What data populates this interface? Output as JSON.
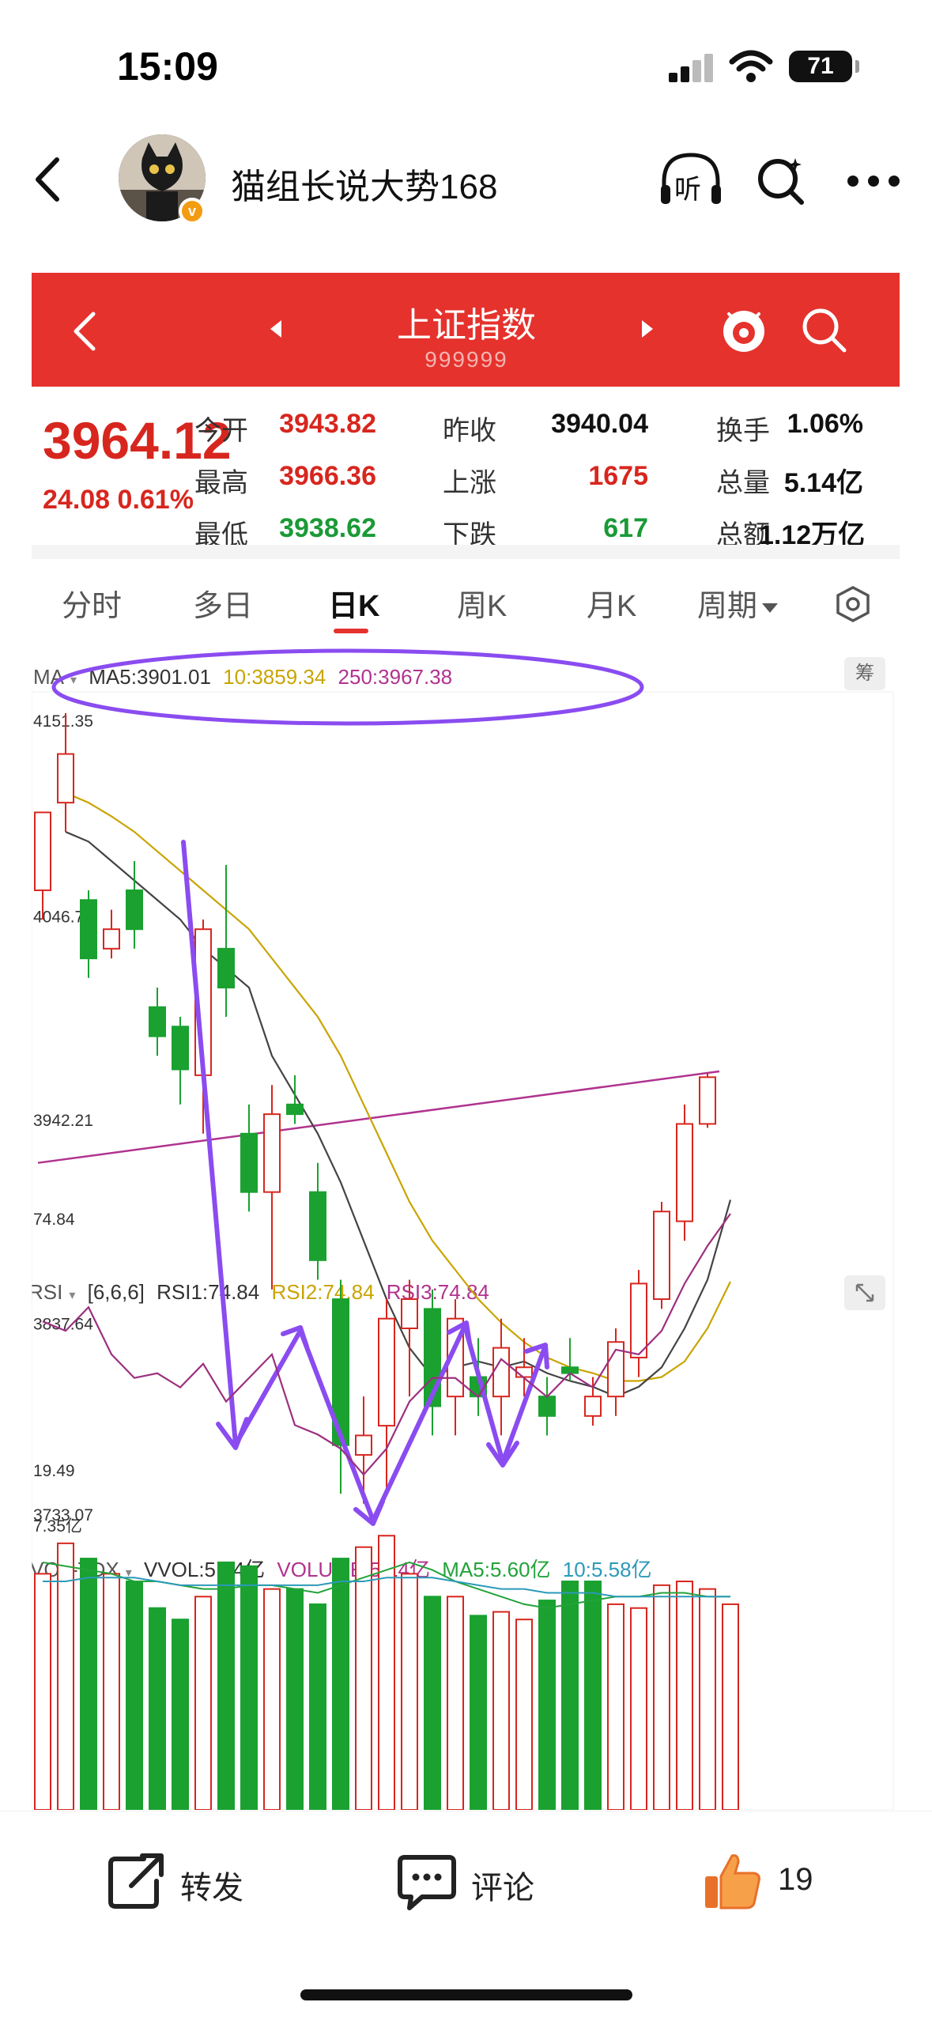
{
  "status_bar": {
    "time": "15:09",
    "battery": "71"
  },
  "nav": {
    "username": "猫组长说大势168",
    "listen_label": "听"
  },
  "quote_app": {
    "title": "上证指数",
    "code": "999999",
    "price": "3964.12",
    "change": "24.08 0.61%",
    "rows": [
      [
        {
          "label": "今开",
          "value": "3943.82",
          "color": "red"
        },
        {
          "label": "昨收",
          "value": "3940.04",
          "color": "dark"
        },
        {
          "label": "换手",
          "value": "1.06%",
          "color": "dark"
        }
      ],
      [
        {
          "label": "最高",
          "value": "3966.36",
          "color": "red"
        },
        {
          "label": "上涨",
          "value": "1675",
          "color": "red"
        },
        {
          "label": "总量",
          "value": "5.14亿",
          "color": "dark"
        }
      ],
      [
        {
          "label": "最低",
          "value": "3938.62",
          "color": "green"
        },
        {
          "label": "下跌",
          "value": "617",
          "color": "green"
        },
        {
          "label": "总额",
          "value": "1.12万亿",
          "color": "dark"
        }
      ]
    ],
    "tabs": [
      "分时",
      "多日",
      "日K",
      "周K",
      "月K",
      "周期"
    ],
    "active_tab": "日K",
    "ma_toggle_label": "筹"
  },
  "indicators": {
    "ma": {
      "name": "MA",
      "ma5": "MA5:3901.01",
      "ma10": "10:3859.34",
      "ma250": "250:3967.38"
    },
    "rsi": {
      "name": "RSI",
      "params": "[6,6,6]",
      "rsi1": "RSI1:74.84",
      "rsi2": "RSI2:74.84",
      "rsi3": "RSI3:74.84"
    },
    "vol": {
      "name": "VOL-TDX",
      "vvol": "VVOL:5.34亿",
      "volume": "VOLUME:5.14亿",
      "ma5": "MA5:5.60亿",
      "ma10": "10:5.58亿"
    }
  },
  "chart_data": [
    {
      "type": "candlestick",
      "title": "",
      "y_ticks": [
        "4151.35",
        "4046.78",
        "3942.21",
        "3837.64",
        "3733.07"
      ],
      "ylim": [
        3733.07,
        4151.35
      ],
      "candles": [
        {
          "o": 4060,
          "h": 4100,
          "l": 4045,
          "c": 4100,
          "up": true
        },
        {
          "o": 4105,
          "h": 4151,
          "l": 4090,
          "c": 4130,
          "up": true
        },
        {
          "o": 4055,
          "h": 4060,
          "l": 4015,
          "c": 4025,
          "up": false
        },
        {
          "o": 4030,
          "h": 4050,
          "l": 4025,
          "c": 4040,
          "up": true
        },
        {
          "o": 4060,
          "h": 4075,
          "l": 4030,
          "c": 4040,
          "up": false
        },
        {
          "o": 4000,
          "h": 4010,
          "l": 3975,
          "c": 3985,
          "up": false
        },
        {
          "o": 3990,
          "h": 3995,
          "l": 3950,
          "c": 3968,
          "up": false
        },
        {
          "o": 3965,
          "h": 4045,
          "l": 3935,
          "c": 4040,
          "up": true
        },
        {
          "o": 4030,
          "h": 4073,
          "l": 3995,
          "c": 4010,
          "up": false
        },
        {
          "o": 3935,
          "h": 3950,
          "l": 3895,
          "c": 3905,
          "up": false
        },
        {
          "o": 3905,
          "h": 3960,
          "l": 3855,
          "c": 3945,
          "up": true
        },
        {
          "o": 3945,
          "h": 3965,
          "l": 3940,
          "c": 3950,
          "up": false
        },
        {
          "o": 3905,
          "h": 3920,
          "l": 3860,
          "c": 3870,
          "up": false
        },
        {
          "o": 3850,
          "h": 3860,
          "l": 3750,
          "c": 3775,
          "up": false
        },
        {
          "o": 3770,
          "h": 3800,
          "l": 3745,
          "c": 3780,
          "up": true
        },
        {
          "o": 3785,
          "h": 3850,
          "l": 3750,
          "c": 3840,
          "up": true
        },
        {
          "o": 3835,
          "h": 3860,
          "l": 3800,
          "c": 3850,
          "up": true
        },
        {
          "o": 3845,
          "h": 3855,
          "l": 3780,
          "c": 3795,
          "up": false
        },
        {
          "o": 3800,
          "h": 3850,
          "l": 3780,
          "c": 3840,
          "up": true
        },
        {
          "o": 3810,
          "h": 3830,
          "l": 3790,
          "c": 3800,
          "up": false
        },
        {
          "o": 3800,
          "h": 3840,
          "l": 3780,
          "c": 3825,
          "up": true
        },
        {
          "o": 3810,
          "h": 3830,
          "l": 3800,
          "c": 3815,
          "up": true
        },
        {
          "o": 3800,
          "h": 3810,
          "l": 3780,
          "c": 3790,
          "up": false
        },
        {
          "o": 3815,
          "h": 3830,
          "l": 3808,
          "c": 3812,
          "up": false
        },
        {
          "o": 3790,
          "h": 3810,
          "l": 3785,
          "c": 3800,
          "up": true
        },
        {
          "o": 3800,
          "h": 3835,
          "l": 3790,
          "c": 3828,
          "up": true
        },
        {
          "o": 3820,
          "h": 3865,
          "l": 3810,
          "c": 3858,
          "up": true
        },
        {
          "o": 3850,
          "h": 3900,
          "l": 3845,
          "c": 3895,
          "up": true
        },
        {
          "o": 3890,
          "h": 3950,
          "l": 3880,
          "c": 3940,
          "up": true
        },
        {
          "o": 3940,
          "h": 3966,
          "l": 3938,
          "c": 3964,
          "up": true
        }
      ],
      "ma5": [
        4090,
        4085,
        4075,
        4065,
        4055,
        4045,
        4030,
        4020,
        4010,
        3975,
        3955,
        3935,
        3910,
        3880,
        3850,
        3825,
        3810,
        3815,
        3818,
        3815,
        3818,
        3812,
        3808,
        3805,
        3800,
        3805,
        3815,
        3835,
        3860,
        3901
      ],
      "ma10": [
        4110,
        4105,
        4098,
        4090,
        4080,
        4070,
        4060,
        4050,
        4040,
        4025,
        4010,
        3995,
        3975,
        3950,
        3925,
        3900,
        3880,
        3865,
        3850,
        3838,
        3828,
        3820,
        3815,
        3812,
        3808,
        3808,
        3810,
        3818,
        3835,
        3859
      ],
      "ma250": [
        3920,
        3967
      ],
      "annotations": "purple ellipse around MA line and hand-drawn purple arrows forming W pattern with upward projection"
    },
    {
      "type": "line",
      "title": "",
      "y_ticks": [
        "74.84",
        "19.49"
      ],
      "ylim": [
        19.49,
        74.84
      ],
      "rsi": [
        52,
        50,
        55,
        45,
        40,
        41,
        38,
        43,
        35,
        40,
        45,
        30,
        28,
        25,
        19.5,
        25,
        35,
        40,
        40,
        36,
        44,
        40,
        36,
        41,
        38,
        46,
        45,
        50,
        60,
        68,
        74.84
      ]
    },
    {
      "type": "bar",
      "title": "",
      "y_ticks": [
        "7.35亿"
      ],
      "ylim": [
        0,
        7.35
      ],
      "volumes": [
        6.2,
        7.0,
        6.6,
        6.2,
        6.0,
        5.3,
        5.0,
        5.6,
        6.5,
        6.4,
        5.8,
        5.8,
        5.4,
        6.6,
        6.9,
        7.2,
        6.2,
        5.6,
        5.6,
        5.1,
        5.2,
        5.0,
        5.5,
        6.0,
        6.0,
        5.4,
        5.3,
        5.9,
        6.0,
        5.8,
        5.4
      ],
      "up": [
        true,
        true,
        false,
        true,
        false,
        false,
        false,
        true,
        false,
        false,
        true,
        false,
        false,
        false,
        true,
        true,
        true,
        false,
        true,
        false,
        true,
        true,
        false,
        false,
        false,
        true,
        true,
        true,
        true,
        true,
        true
      ],
      "ma5_line": [
        6.5,
        6.4,
        6.3,
        6.2,
        6.0,
        6.0,
        5.9,
        5.8,
        5.8,
        5.9,
        5.9,
        5.8,
        5.7,
        5.9,
        6.1,
        6.3,
        6.5,
        6.3,
        6.0,
        5.8,
        5.6,
        5.4,
        5.3,
        5.4,
        5.5,
        5.6,
        5.6,
        5.7,
        5.7,
        5.6,
        5.6
      ],
      "ma10_line": [
        6.0,
        6.0,
        6.1,
        6.1,
        6.1,
        6.0,
        5.9,
        5.9,
        5.9,
        5.9,
        5.9,
        5.9,
        5.9,
        6.0,
        6.0,
        6.1,
        6.1,
        6.1,
        6.0,
        5.9,
        5.8,
        5.8,
        5.7,
        5.7,
        5.7,
        5.6,
        5.6,
        5.6,
        5.6,
        5.6,
        5.6
      ]
    }
  ],
  "bottom_bar": {
    "repost": "转发",
    "comment": "评论",
    "likes": "19"
  },
  "colors": {
    "brand_red": "#e5322d",
    "candle_up": "#d7261e",
    "candle_down": "#1aa130",
    "annotation": "#8a4cf0"
  }
}
